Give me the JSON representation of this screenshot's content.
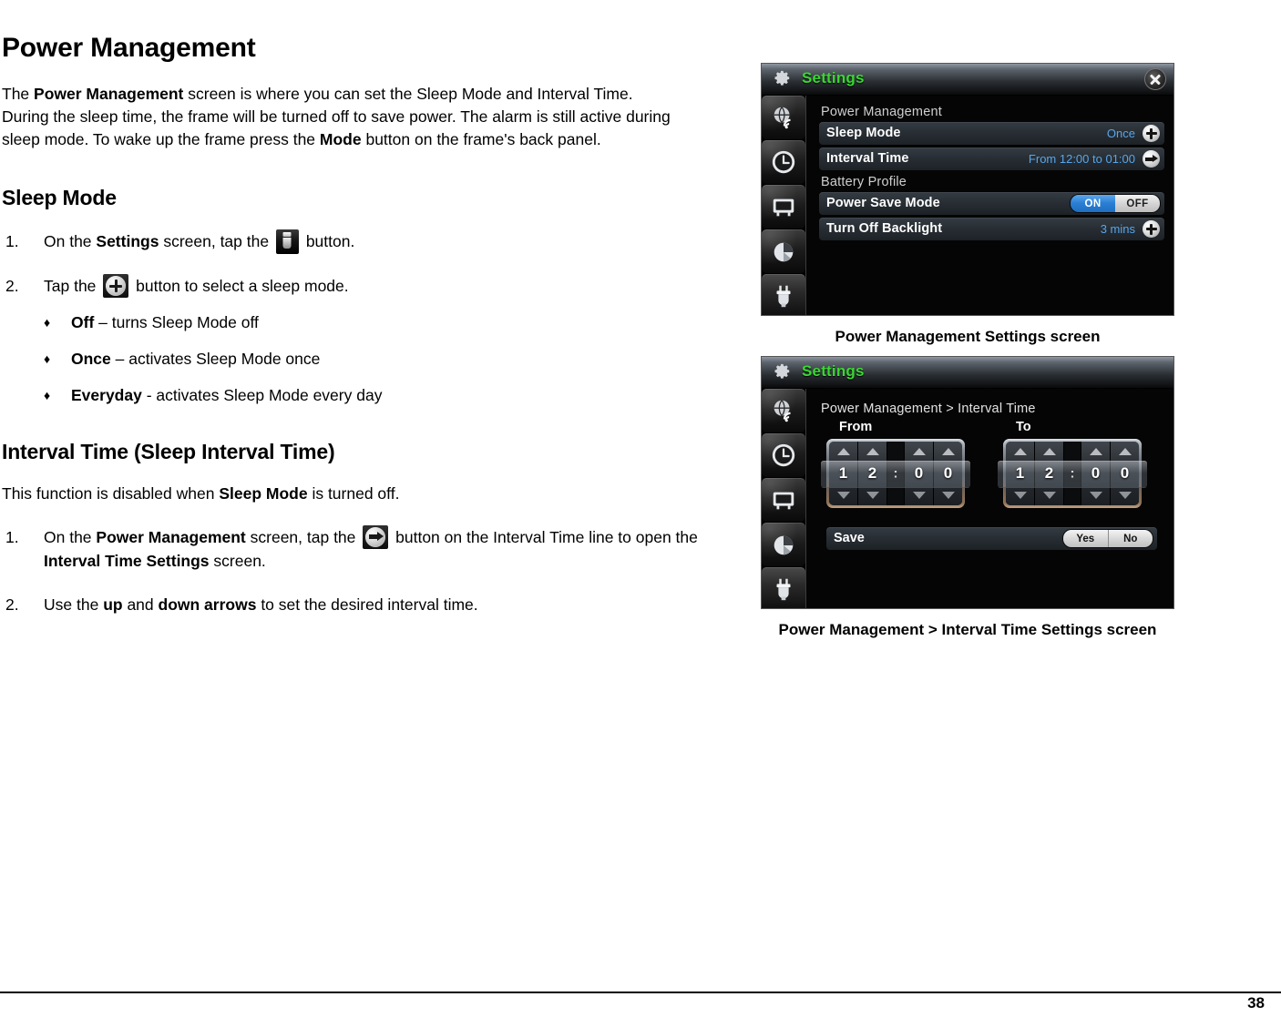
{
  "document": {
    "title": "Power Management",
    "intro_prefix": "The ",
    "intro_bold1": "Power Management",
    "intro_mid": " screen is where you can set the Sleep Mode and Interval Time.  During the sleep time, the frame will be turned off to save power.  The alarm is still active during sleep mode.  To wake up the frame press the ",
    "intro_bold2": "Mode",
    "intro_suffix": " button on the frame's back panel.",
    "page_number": "38"
  },
  "sleep_mode": {
    "heading": "Sleep Mode",
    "step1": {
      "num": "1.",
      "pre": "On the ",
      "bold": "Settings",
      "mid": " screen, tap the ",
      "icon": "power-plug-icon",
      "post": " button."
    },
    "step2": {
      "num": "2.",
      "pre": "Tap the ",
      "icon": "plus-circle-icon",
      "post": " button to select a sleep mode."
    },
    "options": [
      {
        "bullet": "♦",
        "bold": "Off",
        "rest": " – turns Sleep Mode off"
      },
      {
        "bullet": "♦",
        "bold": "Once",
        "rest": " – activates Sleep Mode once"
      },
      {
        "bullet": "♦",
        "bold": "Everyday",
        "rest": " - activates Sleep Mode every day"
      }
    ]
  },
  "interval_time": {
    "heading": "Interval Time (Sleep Interval Time)",
    "note_pre": "This function is disabled when ",
    "note_bold": "Sleep Mode",
    "note_post": " is turned off.",
    "step1": {
      "num": "1.",
      "pre": "On the ",
      "bold1": "Power Management",
      "mid": " screen, tap the ",
      "icon": "arrow-right-circle-icon",
      "post1": " button on the Interval Time line to open the ",
      "bold2": "Interval Time Settings",
      "post2": " screen."
    },
    "step2": {
      "num": "2.",
      "pre": "Use the ",
      "bold1": "up",
      "mid": " and ",
      "bold2": "down arrows",
      "post": " to set the desired interval time."
    }
  },
  "screenshot_power": {
    "caption": "Power Management Settings screen",
    "header": {
      "gear_icon": "gear-icon",
      "title": "Settings",
      "title_color": "#3ad832",
      "close_icon": "close-icon"
    },
    "rail": [
      {
        "name": "network-globe-icon"
      },
      {
        "name": "clock-icon"
      },
      {
        "name": "frame-display-icon"
      },
      {
        "name": "pie-chart-icon"
      },
      {
        "name": "power-plug-icon"
      }
    ],
    "sections": [
      {
        "label": "Power Management"
      },
      {
        "label": "Battery Profile"
      }
    ],
    "rows": [
      {
        "label": "Sleep Mode",
        "value": "Once",
        "control": "plus",
        "value_color": "#56a6ec"
      },
      {
        "label": "Interval Time",
        "value": "From 12:00 to 01:00",
        "control": "arrow",
        "value_color": "#56a6ec"
      },
      {
        "label": "Power Save Mode",
        "value": "",
        "control": "toggle",
        "toggle_on": "ON",
        "toggle_off": "OFF",
        "toggle_state": "ON",
        "on_color": "#2a7fd4"
      },
      {
        "label": "Turn Off Backlight",
        "value": "3 mins",
        "control": "plus",
        "value_color": "#56a6ec"
      }
    ]
  },
  "screenshot_interval": {
    "caption": "Power Management > Interval Time Settings screen",
    "header": {
      "gear_icon": "gear-icon",
      "title": "Settings",
      "title_color": "#3ad832"
    },
    "breadcrumb": "Power Management > Interval Time",
    "rail": [
      {
        "name": "network-globe-icon"
      },
      {
        "name": "clock-icon"
      },
      {
        "name": "frame-display-icon"
      },
      {
        "name": "pie-chart-icon"
      },
      {
        "name": "power-plug-icon"
      }
    ],
    "pickers": [
      {
        "caption": "From",
        "h1": "1",
        "h2": "2",
        "sep": ":",
        "m1": "0",
        "m2": "0"
      },
      {
        "caption": "To",
        "h1": "1",
        "h2": "2",
        "sep": ":",
        "m1": "0",
        "m2": "0"
      }
    ],
    "save": {
      "label": "Save",
      "yes": "Yes",
      "no": "No"
    }
  }
}
